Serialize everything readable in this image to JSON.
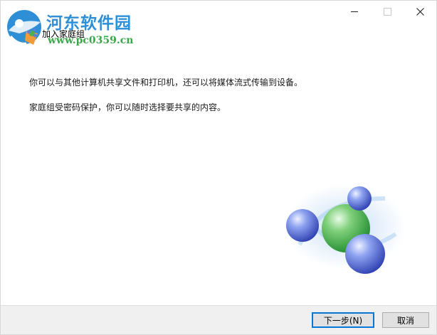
{
  "watermark": {
    "site_name": "河东软件园",
    "url": "www.pc0359.cn"
  },
  "dialog": {
    "title": "加入家庭组",
    "description_line1": "你可以与其他计算机共享文件和打印机，还可以将媒体流式传输到设备。",
    "description_line2": "家庭组受密码保护，你可以随时选择要共享的内容。"
  },
  "buttons": {
    "next_label": "下一步(N)",
    "cancel_label": "取消"
  },
  "icons": {
    "logo": "hedong-logo-icon",
    "app": "homegroup-icon",
    "illustration": "homegroup-spheres-illustration",
    "minimize": "minimize-icon",
    "maximize": "maximize-icon",
    "close": "close-icon"
  },
  "colors": {
    "accent": "#0078d7",
    "watermark_blue": "#2f8fd6",
    "watermark_green": "#3aa84a",
    "footer_bg": "#f0f0f0"
  }
}
